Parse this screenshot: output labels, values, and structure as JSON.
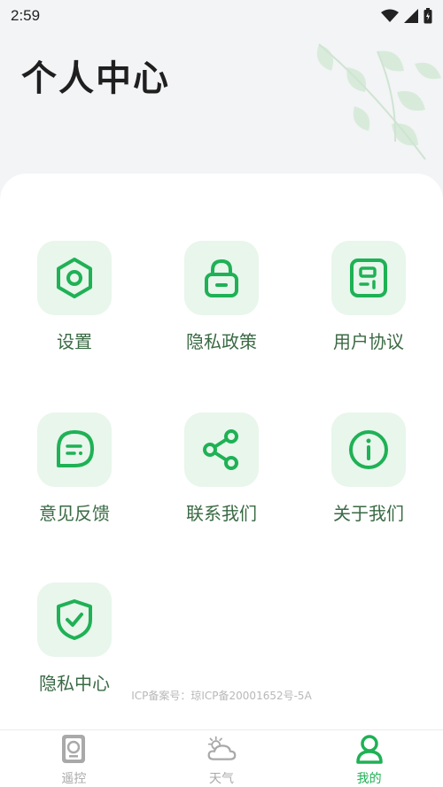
{
  "status_bar": {
    "time": "2:59"
  },
  "page_title": "个人中心",
  "menu": [
    {
      "label": "设置",
      "icon": "settings-hexagon-icon"
    },
    {
      "label": "隐私政策",
      "icon": "lock-icon"
    },
    {
      "label": "用户协议",
      "icon": "document-icon"
    },
    {
      "label": "意见反馈",
      "icon": "chat-bubble-icon"
    },
    {
      "label": "联系我们",
      "icon": "share-icon"
    },
    {
      "label": "关于我们",
      "icon": "info-icon"
    },
    {
      "label": "隐私中心",
      "icon": "shield-check-icon"
    }
  ],
  "icp_text": "ICP备案号：琼ICP备20001652号-5A",
  "tabs": [
    {
      "label": "遥控",
      "icon": "remote-icon",
      "active": false
    },
    {
      "label": "天气",
      "icon": "weather-icon",
      "active": false
    },
    {
      "label": "我的",
      "icon": "profile-icon",
      "active": true
    }
  ],
  "colors": {
    "accent": "#1fb155",
    "icon_bg": "#e8f6ec",
    "label": "#3a6a44"
  }
}
